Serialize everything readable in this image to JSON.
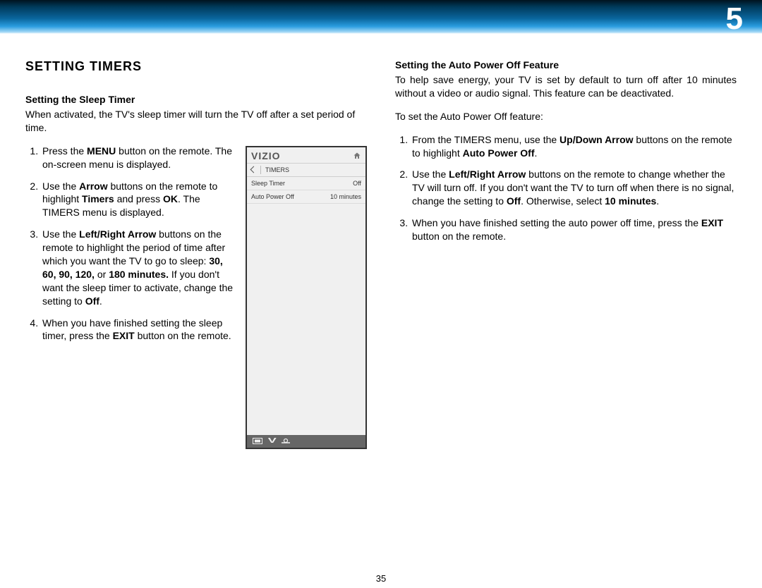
{
  "chapter_number": "5",
  "page_number": "35",
  "section_title": "SETTING TIMERS",
  "left": {
    "subheading": "Setting the Sleep Timer",
    "intro": "When activated, the TV's sleep timer will turn the TV off after a set period of time.",
    "step1_a": "Press the ",
    "step1_key": "MENU",
    "step1_b": " button on the remote. The on-screen menu is displayed.",
    "step2_a": "Use the ",
    "step2_key1": "Arrow",
    "step2_b": " buttons on the remote to highlight ",
    "step2_key2": "Timers",
    "step2_c": " and press ",
    "step2_key3": "OK",
    "step2_d": ". The TIMERS menu is displayed.",
    "step3_a": "Use the ",
    "step3_key1": "Left/Right Arrow",
    "step3_b": " buttons on the remote to highlight the period of time after which you want the TV to go to sleep: ",
    "step3_key2": "30, 60, 90, 120,",
    "step3_c": " or ",
    "step3_key3": "180 minutes.",
    "step3_d": " If you don't want the sleep timer to activate, change the setting to ",
    "step3_key4": "Off",
    "step3_e": ".",
    "step4_a": "When you have finished setting the sleep timer, press the ",
    "step4_key": "EXIT",
    "step4_b": " button on the remote."
  },
  "right": {
    "subheading": "Setting the Auto Power Off Feature",
    "intro": "To help save energy, your TV is set by default to turn off after 10 minutes without a video or audio signal. This feature can be deactivated.",
    "lead": "To set the Auto Power Off feature:",
    "step1_a": "From the TIMERS menu, use the ",
    "step1_key1": "Up/Down Arrow",
    "step1_b": " buttons on the remote to highlight ",
    "step1_key2": "Auto Power Off",
    "step1_c": ".",
    "step2_a": "Use the ",
    "step2_key1": "Left/Right Arrow",
    "step2_b": " buttons on the remote to change whether the TV will turn off. If you don't want the TV to turn off when there is no signal, change the setting to ",
    "step2_key2": "Off",
    "step2_c": ". Otherwise, select ",
    "step2_key3": "10 minutes",
    "step2_d": ".",
    "step3_a": "When you have finished setting the auto power off time, press the ",
    "step3_key": "EXIT",
    "step3_b": " button on the remote."
  },
  "menu": {
    "logo": "VIZIO",
    "title": "TIMERS",
    "rows": [
      {
        "label": "Sleep Timer",
        "value": "Off"
      },
      {
        "label": "Auto Power Off",
        "value": "10 minutes"
      }
    ]
  }
}
